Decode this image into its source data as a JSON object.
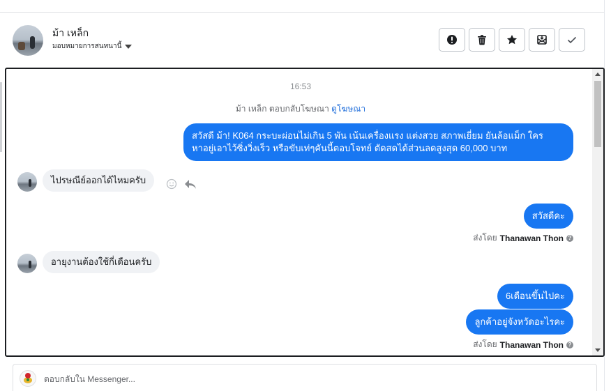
{
  "contact": {
    "name": "ม้า เหล็ก",
    "assign_label": "มอบหมายการสนทนานี้"
  },
  "actions": [
    {
      "name": "mark-spam-button",
      "icon": "exclamation-icon"
    },
    {
      "name": "delete-button",
      "icon": "trash-icon"
    },
    {
      "name": "star-button",
      "icon": "star-icon"
    },
    {
      "name": "move-to-inbox-button",
      "icon": "inbox-icon"
    },
    {
      "name": "mark-done-button",
      "icon": "check-icon"
    }
  ],
  "conversation": {
    "timestamp": "16:53",
    "ad_notice": {
      "prefix": "ม้า เหล็ก ตอบกลับโฆษณา",
      "link": "ดูโฆษณา"
    },
    "messages": [
      {
        "direction": "out",
        "text_line1": "สวัสดี ม้า! K064 กระบะผ่อนไม่เกิน 5 พัน เน้นเครื่องแรง แต่งสวย สภาพเยี่ยม ยันล้อแม็ก ใคร",
        "text_line2": "หาอยู่เอาไว้ซิ่งวิ่งเร็ว หรือขับเท่ๆคันนี้ตอบโจทย์ ตัดสดได้ส่วนลดสูงสุด 60,000 บาท"
      },
      {
        "direction": "in",
        "text": "ไปรษณีย์ออกได้ไหมครับ"
      },
      {
        "direction": "out",
        "text": "สวัสดีคะ"
      },
      {
        "direction": "in",
        "text": "อายุงานต้องใช้กี่เดือนครับ"
      },
      {
        "direction": "out",
        "text": "6เดือนขึ้นไปคะ"
      },
      {
        "direction": "out",
        "text": "ลูกค้าอยู่จังหวัดอะไรคะ"
      }
    ],
    "sent_by_label": "ส่งโดย",
    "sent_by_name": "Thanawan Thon"
  },
  "composer": {
    "placeholder": "ตอบกลับใน Messenger..."
  }
}
